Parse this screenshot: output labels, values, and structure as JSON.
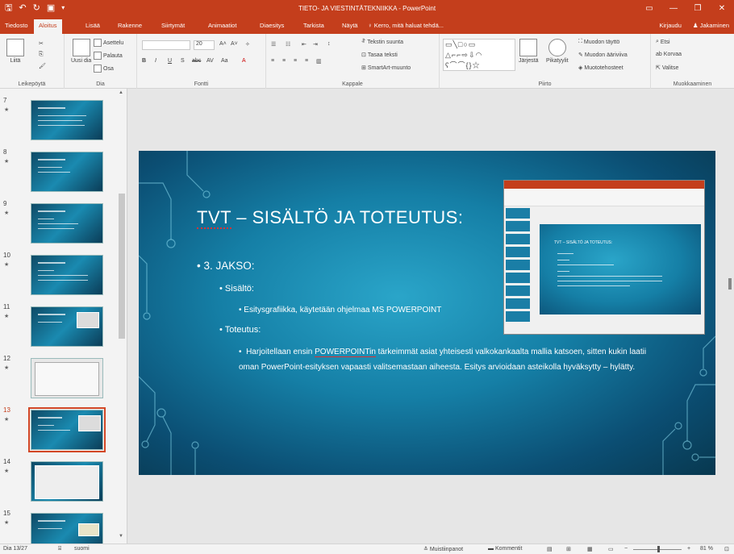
{
  "titlebar": {
    "title": "TIETO- JA VIESTINTÄTEKNIIKKA - PowerPoint",
    "qat": [
      "save-icon",
      "undo-icon",
      "redo-icon",
      "present-icon"
    ],
    "window_buttons": [
      "restore-ribbon-icon",
      "minimize-icon",
      "maximize-icon",
      "close-icon"
    ]
  },
  "tabs": {
    "items": [
      "Tiedosto",
      "Aloitus",
      "Lisää",
      "Rakenne",
      "Siirtymät",
      "Animaatiot",
      "Diaesitys",
      "Tarkista",
      "Näytä"
    ],
    "active": "Aloitus",
    "tell_me": "Kerro, mitä haluat tehdä...",
    "sign_in": "Kirjaudu",
    "share": "Jakaminen"
  },
  "ribbon": {
    "clipboard": {
      "paste": "Liitä",
      "label": "Leikepöytä"
    },
    "slides": {
      "new_slide": "Uusi dia",
      "layout": "Asettelu",
      "reset": "Palauta",
      "section": "Osa",
      "label": "Dia"
    },
    "font": {
      "size": "20",
      "label": "Fontti",
      "buttons": [
        "B",
        "I",
        "U",
        "S",
        "abc",
        "AV",
        "Aa",
        "A"
      ]
    },
    "paragraph": {
      "text_direction": "Tekstin suunta",
      "align_text": "Tasaa teksti",
      "smartart": "SmartArt-muunto",
      "label": "Kappale"
    },
    "drawing": {
      "arrange": "Järjestä",
      "quick_styles": "Pikatyylit",
      "fill": "Muodon täyttö",
      "outline": "Muodon ääriviiva",
      "effects": "Muototehosteet",
      "label": "Piirto"
    },
    "editing": {
      "find": "Etsi",
      "replace": "Korvaa",
      "select": "Valitse",
      "label": "Muokkaaminen"
    }
  },
  "thumbnails": [
    {
      "num": "7"
    },
    {
      "num": "8"
    },
    {
      "num": "9"
    },
    {
      "num": "10"
    },
    {
      "num": "11"
    },
    {
      "num": "12"
    },
    {
      "num": "13",
      "selected": true
    },
    {
      "num": "14"
    },
    {
      "num": "15"
    }
  ],
  "slide": {
    "title": "TVT – SISÄLTÖ JA TOTEUTUS:",
    "title_part1": "TVT",
    "title_part2": " – SISÄLTÖ JA TOTEUTUS:",
    "bullet1": "• 3. JAKSO:",
    "sub1": "• Sisältö:",
    "sub1_item": "• Esitysgrafiikka, käytetään ohjelmaa MS POWERPOINT",
    "sub2": "• Toteutus:",
    "para_bullet": "•",
    "para_a": "Harjoitellaan ensin ",
    "para_ul": "POWERPOINTin",
    "para_b": " tärkeimmät asiat yhteisesti valkokankaalta mallia katsoen, sitten kukin laatii oman PowerPoint-esityksen vapaasti valitsemastaan aiheesta. Esitys arvioidaan asteikolla hyväksytty – hylätty.",
    "embedded_title": "TVT – SISÄLTÖ JA TOTEUTUS:"
  },
  "status": {
    "slide": "Dia 13/27",
    "language": "suomi",
    "notes": "Muistiinpanot",
    "comments": "Kommentit",
    "zoom": "81 %"
  },
  "colors": {
    "accent": "#c43e1c",
    "slide_bg": "#157fa6",
    "selected_outline": "#d24726"
  }
}
